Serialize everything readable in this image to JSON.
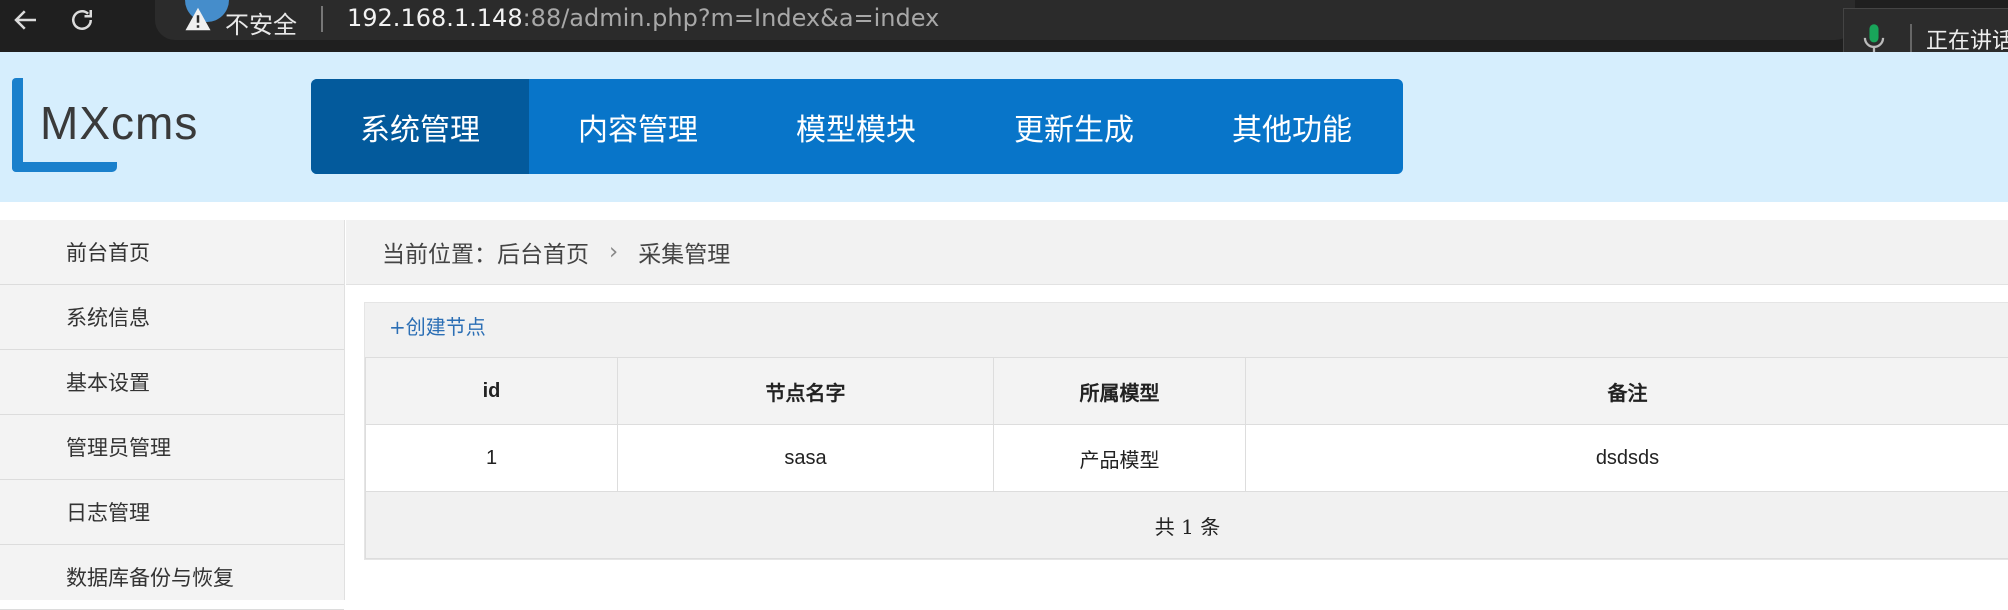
{
  "browser": {
    "security_label": "不安全",
    "url_host": "192.168.1.148",
    "url_rest": ":88/admin.php?m=Index&a=index",
    "speech_status": "正在讲话"
  },
  "app": {
    "logo_text": "MXcms",
    "logo_color": "#1a80cc",
    "header_bg": "#d6eefd",
    "nav_color": "#0875c9",
    "nav_active_color": "#035a9c"
  },
  "main_nav": {
    "tabs": [
      {
        "label": "系统管理",
        "active": true
      },
      {
        "label": "内容管理",
        "active": false
      },
      {
        "label": "模型模块",
        "active": false
      },
      {
        "label": "更新生成",
        "active": false
      },
      {
        "label": "其他功能",
        "active": false
      }
    ]
  },
  "sidebar": {
    "items": [
      {
        "label": "前台首页"
      },
      {
        "label": "系统信息"
      },
      {
        "label": "基本设置"
      },
      {
        "label": "管理员管理"
      },
      {
        "label": "日志管理"
      },
      {
        "label": "数据库备份与恢复"
      }
    ]
  },
  "breadcrumb": {
    "prefix": "当前位置：",
    "home": "后台首页",
    "arrow": "›",
    "current": "采集管理"
  },
  "nodes": {
    "create_label": "+创建节点",
    "columns": [
      "id",
      "节点名字",
      "所属模型",
      "备注"
    ],
    "rows": [
      [
        "1",
        "sasa",
        "产品模型",
        "dsdsds"
      ]
    ],
    "total_text": "共 1 条"
  }
}
